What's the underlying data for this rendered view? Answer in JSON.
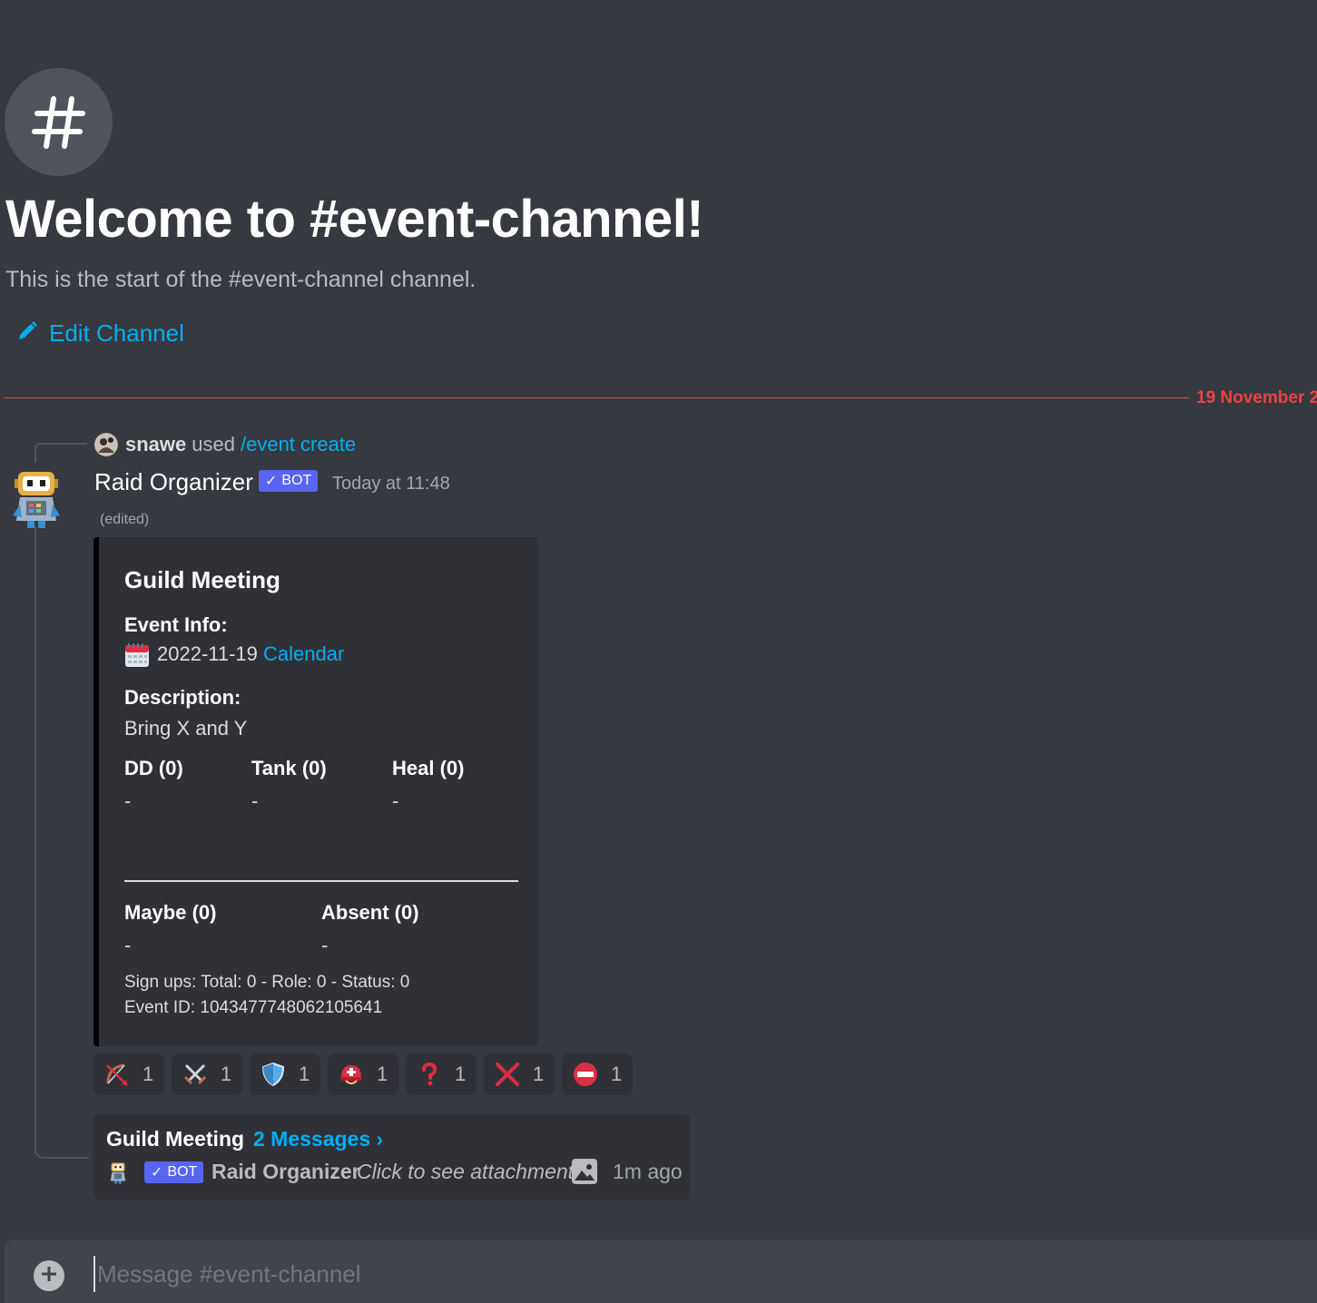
{
  "channel": {
    "welcome_title": "Welcome to #event-channel!",
    "welcome_subtitle": "This is the start of the #event-channel channel.",
    "edit_label": "Edit Channel"
  },
  "date_divider": "19 November 2",
  "reply": {
    "user": "snawe",
    "used": "used",
    "command": "/event create"
  },
  "message": {
    "author": "Raid Organizer",
    "bot_label": "BOT",
    "timestamp": "Today at 11:48",
    "edited": "(edited)"
  },
  "embed": {
    "accent_color": "#000000",
    "title": "Guild Meeting",
    "event_info_label": "Event Info:",
    "event_date": "2022-11-19",
    "calendar_link": "Calendar",
    "description_label": "Description:",
    "description": "Bring X and Y",
    "roles": [
      {
        "name": "DD (0)",
        "value": "-"
      },
      {
        "name": "Tank (0)",
        "value": "-"
      },
      {
        "name": "Heal (0)",
        "value": "-"
      }
    ],
    "statuses": [
      {
        "name": "Maybe (0)",
        "value": "-"
      },
      {
        "name": "Absent (0)",
        "value": "-"
      }
    ],
    "signups": "Sign ups: Total: 0 - Role: 0 - Status: 0",
    "event_id": "Event ID: 1043477748062105641"
  },
  "reactions": [
    {
      "icon": "bow-icon",
      "count": "1"
    },
    {
      "icon": "crossed-swords-icon",
      "count": "1"
    },
    {
      "icon": "shield-icon",
      "count": "1"
    },
    {
      "icon": "rescue-helmet-icon",
      "count": "1"
    },
    {
      "icon": "question-mark-icon",
      "count": "1"
    },
    {
      "icon": "cross-mark-icon",
      "count": "1"
    },
    {
      "icon": "no-entry-icon",
      "count": "1"
    }
  ],
  "thread": {
    "name": "Guild Meeting",
    "message_count": "2 Messages ›",
    "bot_label": "BOT",
    "author": "Raid Organizer",
    "preview": "Click to see attachment",
    "time": "1m ago"
  },
  "composer": {
    "placeholder": "Message #event-channel"
  },
  "colors": {
    "background": "#36393f",
    "link": "#00aff4",
    "divider_red": "#ed4245",
    "bot_badge": "#5865f2"
  }
}
